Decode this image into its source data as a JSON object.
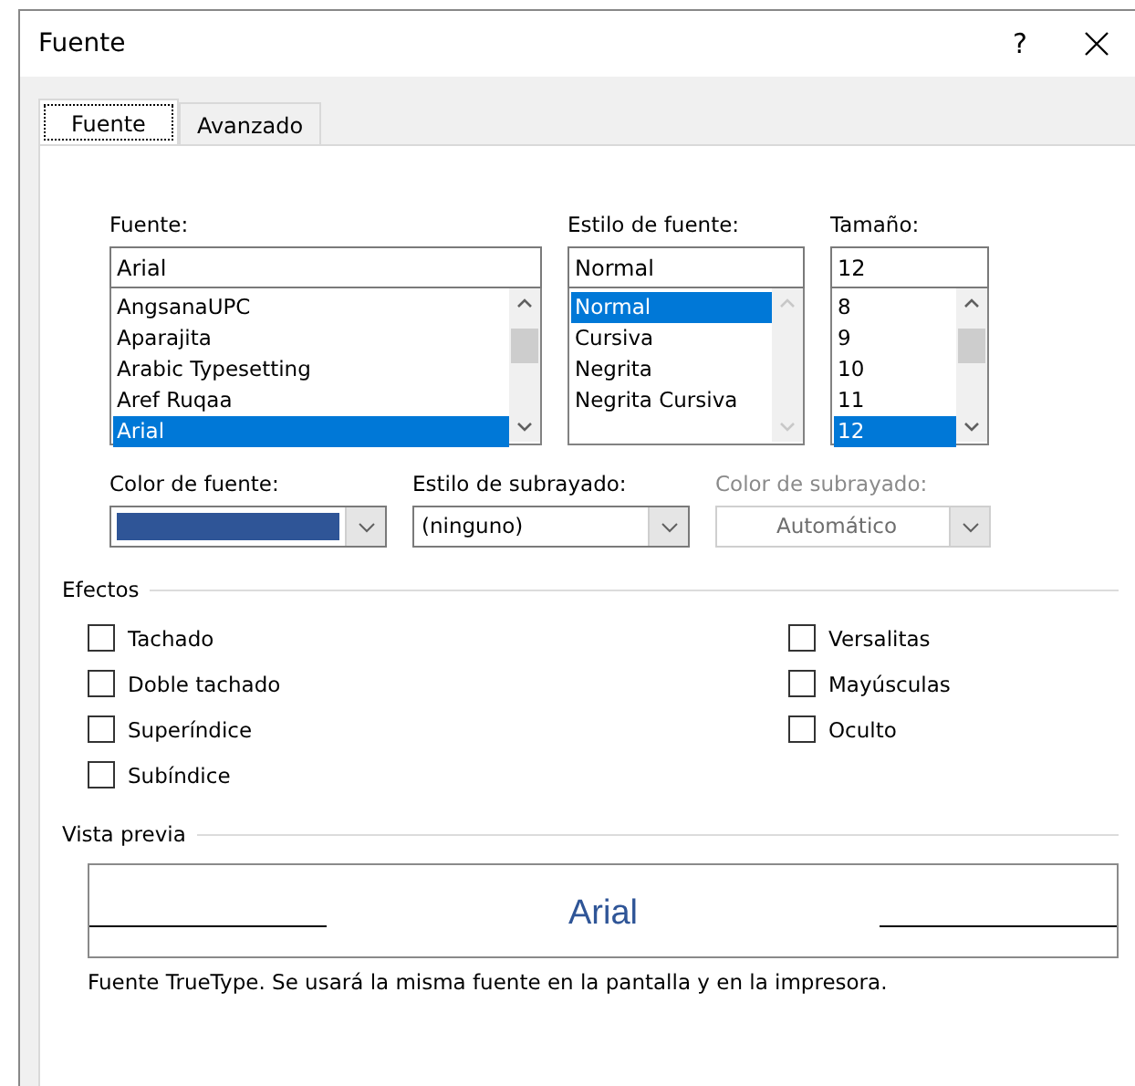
{
  "window": {
    "title": "Fuente",
    "help": "?"
  },
  "tabs": [
    {
      "label": "Fuente",
      "selected": true
    },
    {
      "label": "Avanzado",
      "selected": false
    }
  ],
  "pickers": [
    {
      "label": "Fuente:",
      "value": "Arial",
      "scrollbar_disabled": false,
      "items": [
        {
          "text": "AngsanaUPC",
          "selected": false
        },
        {
          "text": "Aparajita",
          "selected": false
        },
        {
          "text": "Arabic Typesetting",
          "selected": false
        },
        {
          "text": "Aref Ruqaa",
          "selected": false
        },
        {
          "text": "Arial",
          "selected": true
        }
      ]
    },
    {
      "label": "Estilo de fuente:",
      "value": "Normal",
      "scrollbar_disabled": true,
      "items": [
        {
          "text": "Normal",
          "selected": true
        },
        {
          "text": "Cursiva",
          "selected": false
        },
        {
          "text": "Negrita",
          "selected": false
        },
        {
          "text": "Negrita Cursiva",
          "selected": false
        }
      ]
    },
    {
      "label": "Tamaño:",
      "value": "12",
      "scrollbar_disabled": false,
      "items": [
        {
          "text": "8",
          "selected": false
        },
        {
          "text": "9",
          "selected": false
        },
        {
          "text": "10",
          "selected": false
        },
        {
          "text": "11",
          "selected": false
        },
        {
          "text": "12",
          "selected": true
        }
      ]
    }
  ],
  "dropdowns": [
    {
      "kind": "swatch",
      "label": "Color de fuente:",
      "color": "#2f5597",
      "disabled": false
    },
    {
      "kind": "text",
      "label": "Estilo de subrayado:",
      "value": "(ninguno)",
      "disabled": false
    },
    {
      "kind": "text",
      "label": "Color de subrayado:",
      "value": "Automático",
      "disabled": true
    }
  ],
  "effects": {
    "title": "Efectos",
    "left": [
      {
        "label": "Tachado",
        "checked": false
      },
      {
        "label": "Doble tachado",
        "checked": false
      },
      {
        "label": "Superíndice",
        "checked": false
      },
      {
        "label": "Subíndice",
        "checked": false
      }
    ],
    "right": [
      {
        "label": "Versalitas",
        "checked": false
      },
      {
        "label": "Mayúsculas",
        "checked": false
      },
      {
        "label": "Oculto",
        "checked": false
      }
    ]
  },
  "preview": {
    "title": "Vista previa",
    "sample": "Arial",
    "caption": "Fuente TrueType. Se usará la misma fuente en la pantalla y en la impresora."
  }
}
